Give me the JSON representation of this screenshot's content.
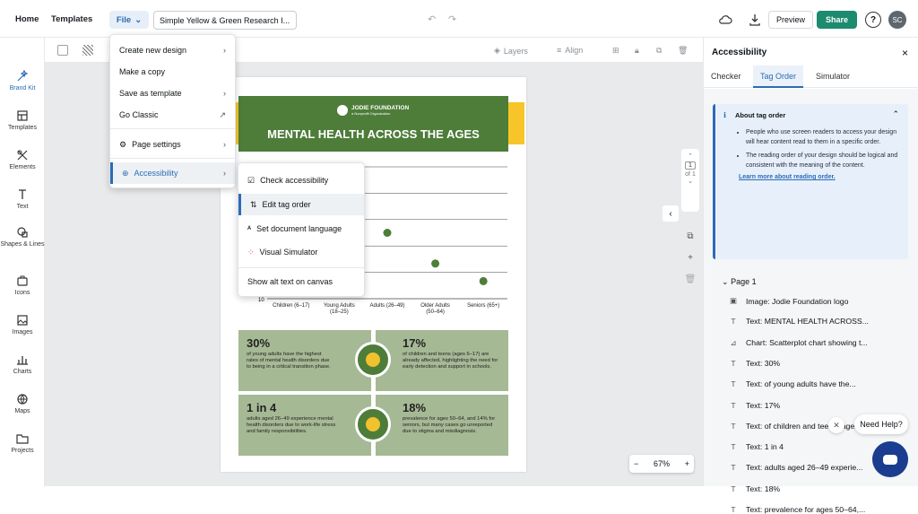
{
  "topbar": {
    "home": "Home",
    "templates": "Templates",
    "file": "File",
    "title": "Simple Yellow & Green Research I...",
    "preview": "Preview",
    "share": "Share",
    "help": "?",
    "avatar": "SC"
  },
  "sidebar": [
    {
      "label": "Brand Kit",
      "icon": "brand-kit-icon"
    },
    {
      "label": "Templates",
      "icon": "templates-icon"
    },
    {
      "label": "Elements",
      "icon": "elements-icon"
    },
    {
      "label": "Text",
      "icon": "text-icon"
    },
    {
      "label": "Shapes & Lines",
      "icon": "shapes-icon"
    },
    {
      "label": "Icons",
      "icon": "icons-icon"
    },
    {
      "label": "Images",
      "icon": "images-icon"
    },
    {
      "label": "Charts",
      "icon": "charts-icon"
    },
    {
      "label": "Maps",
      "icon": "maps-icon"
    },
    {
      "label": "Projects",
      "icon": "projects-icon"
    }
  ],
  "canvas_toolbar": {
    "layers": "Layers",
    "align": "Align"
  },
  "file_menu": {
    "items": [
      "Create new design",
      "Make a copy",
      "Save as template",
      "Go Classic",
      "Page settings",
      "Accessibility"
    ]
  },
  "accessibility_menu": {
    "items": [
      "Check accessibility",
      "Edit tag order",
      "Set document language",
      "Visual Simulator",
      "Show alt text on canvas"
    ]
  },
  "design": {
    "org": "JODIE FOUNDATION",
    "org_sub": "a Nonprofit Organization",
    "headline": "MENTAL HEALTH ACROSS THE AGES",
    "stats": [
      {
        "big": "30%",
        "text": "of young adults have the highest rates of mental health disorders due to being in a critical transition phase."
      },
      {
        "big": "17%",
        "text": "of children and teens (ages 6–17) are already affected, highlighting the need for early detection and support in schools."
      },
      {
        "big": "1 in 4",
        "text": "adults aged 26–49 experience mental health disorders due to work-life stress and family responsibilities."
      },
      {
        "big": "18%",
        "text": "prevalence for ages 50–64, and 14% for seniors, but many cases go unreported due to stigma and misdiagnosis."
      }
    ]
  },
  "chart_data": {
    "type": "scatter",
    "categories": [
      "Children (6–17)",
      "Young Adults (18–25)",
      "Adults (26–49)",
      "Older Adults (50–64)",
      "Seniors (65+)"
    ],
    "values": [
      null,
      null,
      25,
      18,
      14
    ],
    "y_tick_min": "10",
    "color": "#4e7d3a"
  },
  "page_nav": {
    "current": "1",
    "of": "of 1"
  },
  "zoom": "67%",
  "panel": {
    "title": "Accessibility",
    "close": "×",
    "tabs": [
      "Checker",
      "Tag Order",
      "Simulator"
    ],
    "info_title": "About tag order",
    "info_points": [
      "People who use screen readers to access your design will hear content read to them in a specific order.",
      "The reading order of your design should be logical and consistent with the meaning of the content."
    ],
    "info_link": "Learn more about reading order.",
    "page_label": "Page 1",
    "tags": [
      "Image: Jodie Foundation logo",
      "Text: MENTAL HEALTH ACROSS...",
      "Chart: Scatterplot chart showing t...",
      "Text: 30%",
      "Text: of young adults have the...",
      "Text: 17%",
      "Text: of children and teens (ages ...",
      "Text: 1 in 4",
      "Text: adults aged 26–49 experie...",
      "Text: 18%",
      "Text: prevalence for ages 50–64,..."
    ]
  },
  "need_help": "Need Help?"
}
